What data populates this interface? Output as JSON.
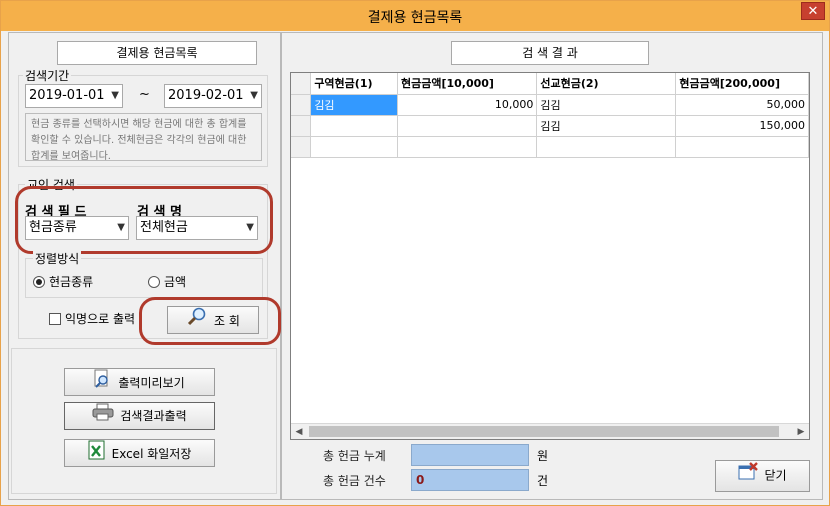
{
  "window": {
    "title": "결제용 현금목록",
    "close_label": "✕"
  },
  "left": {
    "header": "결제용 현금목록",
    "period": {
      "legend": "검색기간",
      "from": "2019-01-01",
      "tilde": "~",
      "to": "2019-02-01",
      "note": "현금 종류를 선택하시면 해당 현금에 대한 총 합계를 확인할 수 있습니다. 전체현금은 각각의 현금에 대한 합계를 보여줍니다."
    },
    "search": {
      "legend": "교인 검색",
      "field_label": "검 색 필 드",
      "name_label": "검 색 명",
      "field_value": "현금종류",
      "name_value": "전체현금"
    },
    "sort": {
      "legend": "정렬방식",
      "option1": "현금종류",
      "option2": "금액",
      "selected": "현금종류"
    },
    "anonymous_label": "익명으로 출력",
    "query_button": "조  회",
    "preview_button": "출력미리보기",
    "print_button": "검색결과출력",
    "excel_button": "Excel 화일저장"
  },
  "right": {
    "header": "검 색 결 과",
    "columns": [
      "구역현금(1)",
      "현금금액[10,000]",
      "선교현금(2)",
      "현금금액[200,000]"
    ],
    "rows": [
      [
        "김김",
        "10,000",
        "김김",
        "50,000"
      ],
      [
        "",
        "",
        "김김",
        "150,000"
      ],
      [
        "",
        "",
        "",
        ""
      ]
    ],
    "total_amount_label": "총 헌금 누계",
    "total_amount_value": "",
    "total_amount_unit": "원",
    "total_count_label": "총 헌금 건수",
    "total_count_value": "0",
    "total_count_unit": "건",
    "close_button": "닫기"
  }
}
